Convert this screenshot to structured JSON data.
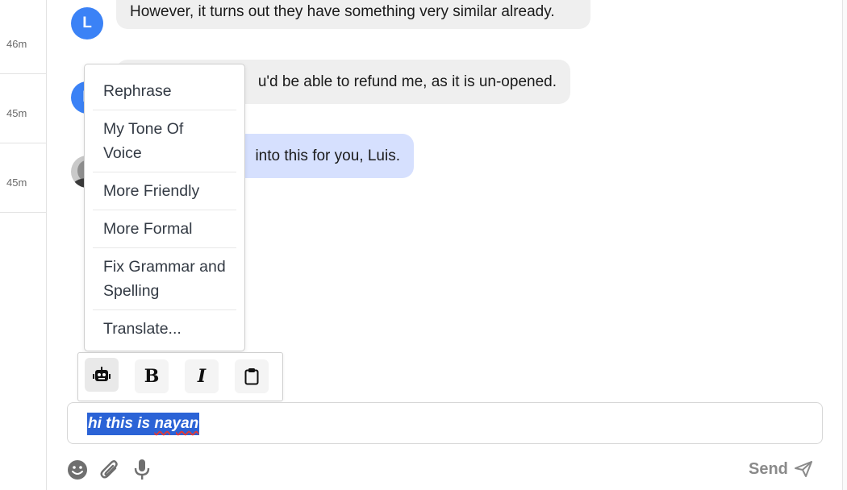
{
  "timestamps": [
    "46m",
    "45m",
    "45m"
  ],
  "messages": [
    {
      "sender_initial": "L",
      "text": "However, it turns out they have something very similar already."
    },
    {
      "sender_initial": "L",
      "text": "u'd be able to refund me, as it is un-opened."
    },
    {
      "text": "into this for you, Luis."
    }
  ],
  "ai_menu": {
    "items": [
      "Rephrase",
      "My Tone Of Voice",
      "More Friendly",
      "More Formal",
      "Fix Grammar and Spelling",
      "Translate..."
    ]
  },
  "toolbar": {
    "buttons": [
      "robot-icon",
      "bold-icon",
      "italic-icon",
      "clipboard-icon"
    ],
    "bold_glyph": "B",
    "italic_glyph": "I"
  },
  "composer": {
    "value_prefix": "hi this is ",
    "value_misspelled": "nayan"
  },
  "footer": {
    "icons": [
      "emoji-icon",
      "attachment-icon",
      "microphone-icon"
    ],
    "send_label": "Send"
  },
  "colors": {
    "avatar": "#3b82f6",
    "outgoing_bubble": "#d6e0fe",
    "incoming_bubble": "#efefef",
    "selection": "#2b63d6"
  }
}
